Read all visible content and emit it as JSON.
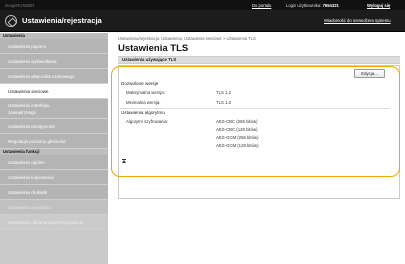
{
  "topbar": {
    "brand": "imageRUNNER",
    "portal_link": "Do portalu",
    "login_label": "Login użytkownika:",
    "login_user": "7654321",
    "logout": "Wyloguj się"
  },
  "header": {
    "title": "Ustawienia/rejestracja",
    "mail_link": "Wiadomość do menedżera systemu"
  },
  "sidebar": {
    "section1": "Ustawienia",
    "items": [
      "Ustawienia papieru",
      "Ustawienia wyświetlania",
      "Ustawienia włącznika czasowego",
      "Ustawienia sieciowe",
      "Ustawienia interfejsu zewnętrznego",
      "Ustawienia dostępności",
      "Regulacja poziomu głośności"
    ],
    "section2": "Ustawienia funkcji",
    "items2": [
      "Ustawienia ogólne",
      "Ustawienia kopiowania",
      "Ustawienia drukarki",
      "Ustawienia wysyłania",
      "Ustawienia odbierania/przekazywania"
    ]
  },
  "main": {
    "breadcrumb": "Ustawienia/rejestracja: Ustawienia: Ustawienia sieciowe > Ustawienia TLS",
    "title": "Ustawienia TLS",
    "table_header": "Ustawienia używające TLS",
    "edit_button": "Edycja...",
    "sections": {
      "versions_title": "Dozwolone wersje",
      "max_label": "Maksymalna wersja:",
      "max_value": "TLS 1.2",
      "min_label": "Minimalna wersja:",
      "min_value": "TLS 1.0",
      "alg_title": "Ustawienia algorytmu",
      "enc_label": "Algorytm szyfrowania:",
      "algorithms": [
        "AES-CBC (256 bitów)",
        "AES-CBC (128 bitów)",
        "AES-GCM (256 bitów)",
        "AES-GCM (128 bitów)"
      ]
    }
  },
  "colors": {
    "highlight": "#f0a500",
    "header_bg": "#1c1c1c",
    "sidebar_bg": "#b4b4b4"
  }
}
